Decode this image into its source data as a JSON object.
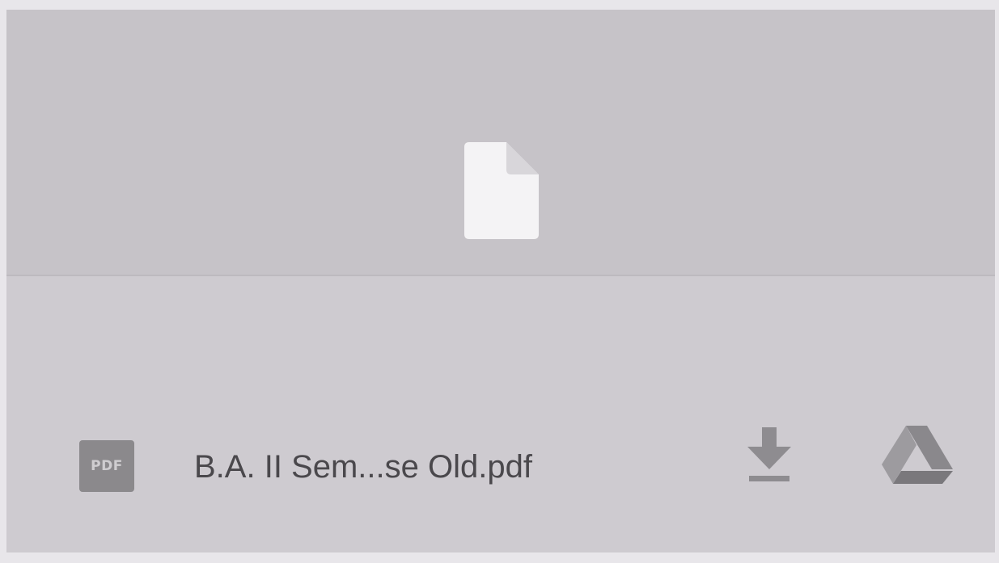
{
  "attachment": {
    "preview": {
      "icon": "generic-file-icon"
    },
    "file_type_badge": "PDF",
    "file_name": "B.A. II Sem...se Old.pdf",
    "actions": {
      "download_icon": "download-icon",
      "drive_icon": "google-drive-icon"
    }
  }
}
